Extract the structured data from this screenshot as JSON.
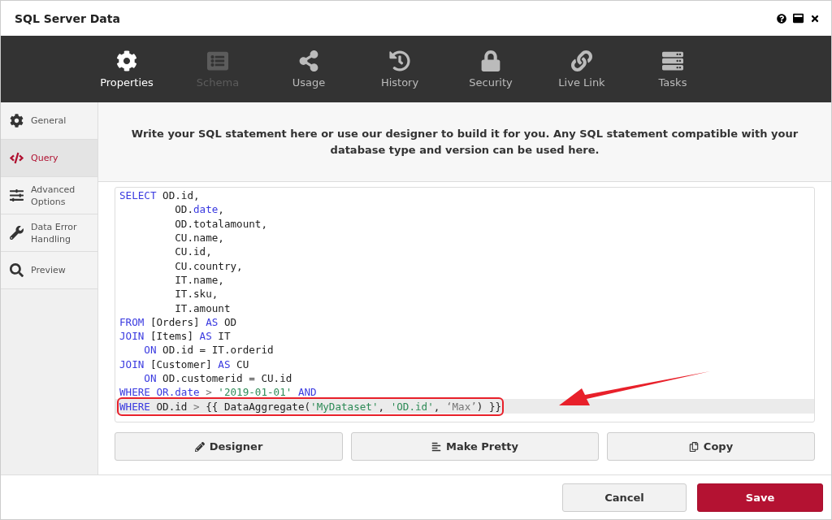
{
  "window": {
    "title": "SQL Server Data"
  },
  "nav_tabs": [
    {
      "label": "Properties",
      "selected": true,
      "disabled": false
    },
    {
      "label": "Schema",
      "selected": false,
      "disabled": true
    },
    {
      "label": "Usage",
      "selected": false,
      "disabled": false
    },
    {
      "label": "History",
      "selected": false,
      "disabled": false
    },
    {
      "label": "Security",
      "selected": false,
      "disabled": false
    },
    {
      "label": "Live Link",
      "selected": false,
      "disabled": false
    },
    {
      "label": "Tasks",
      "selected": false,
      "disabled": false
    }
  ],
  "sidebar": {
    "items": [
      {
        "label": "General",
        "selected": false
      },
      {
        "label": "Query",
        "selected": true
      },
      {
        "label": "Advanced Options",
        "selected": false
      },
      {
        "label": "Data Error Handling",
        "selected": false
      },
      {
        "label": "Preview",
        "selected": false
      }
    ]
  },
  "description": "Write your SQL statement here or use our designer to build it for you. Any SQL statement compatible with your database type and version can be used here.",
  "editor": {
    "lines": [
      {
        "highlighted": false,
        "tokens": [
          {
            "t": "SELECT",
            "kind": "keyword"
          },
          {
            "t": " OD.id,",
            "kind": "plain"
          }
        ]
      },
      {
        "highlighted": false,
        "tokens": [
          {
            "t": "         OD.",
            "kind": "plain"
          },
          {
            "t": "date",
            "kind": "keyword"
          },
          {
            "t": ",",
            "kind": "plain"
          }
        ]
      },
      {
        "highlighted": false,
        "tokens": [
          {
            "t": "         OD.totalamount,",
            "kind": "plain"
          }
        ]
      },
      {
        "highlighted": false,
        "tokens": [
          {
            "t": "         CU.name,",
            "kind": "plain"
          }
        ]
      },
      {
        "highlighted": false,
        "tokens": [
          {
            "t": "         CU.id,",
            "kind": "plain"
          }
        ]
      },
      {
        "highlighted": false,
        "tokens": [
          {
            "t": "         CU.country,",
            "kind": "plain"
          }
        ]
      },
      {
        "highlighted": false,
        "tokens": [
          {
            "t": "         IT.name,",
            "kind": "plain"
          }
        ]
      },
      {
        "highlighted": false,
        "tokens": [
          {
            "t": "         IT.sku,",
            "kind": "plain"
          }
        ]
      },
      {
        "highlighted": false,
        "tokens": [
          {
            "t": "         IT.amount",
            "kind": "plain"
          }
        ]
      },
      {
        "highlighted": false,
        "tokens": [
          {
            "t": "FROM",
            "kind": "keyword"
          },
          {
            "t": " [Orders] ",
            "kind": "plain"
          },
          {
            "t": "AS",
            "kind": "keyword"
          },
          {
            "t": " OD",
            "kind": "plain"
          }
        ]
      },
      {
        "highlighted": false,
        "tokens": [
          {
            "t": "JOIN",
            "kind": "keyword"
          },
          {
            "t": " [Items] ",
            "kind": "plain"
          },
          {
            "t": "AS",
            "kind": "keyword"
          },
          {
            "t": " IT",
            "kind": "plain"
          }
        ]
      },
      {
        "highlighted": false,
        "tokens": [
          {
            "t": "    ON",
            "kind": "keyword"
          },
          {
            "t": " OD.id = IT.orderid",
            "kind": "plain"
          }
        ]
      },
      {
        "highlighted": false,
        "tokens": [
          {
            "t": "JOIN",
            "kind": "keyword"
          },
          {
            "t": " [Customer] ",
            "kind": "plain"
          },
          {
            "t": "AS",
            "kind": "keyword"
          },
          {
            "t": " CU",
            "kind": "plain"
          }
        ]
      },
      {
        "highlighted": false,
        "tokens": [
          {
            "t": "    ON",
            "kind": "keyword"
          },
          {
            "t": " OD.customerid = CU.id",
            "kind": "plain"
          }
        ]
      },
      {
        "highlighted": false,
        "tokens": [
          {
            "t": "WHERE OR.date",
            "kind": "keyword"
          },
          {
            "t": " > ",
            "kind": "operator"
          },
          {
            "t": "'2019-01-01'",
            "kind": "string"
          },
          {
            "t": " AND",
            "kind": "keyword"
          }
        ]
      },
      {
        "highlighted": true,
        "tokens": [
          {
            "t": "WHERE",
            "kind": "keyword"
          },
          {
            "t": " OD.id ",
            "kind": "plain"
          },
          {
            "t": ">",
            "kind": "operator"
          },
          {
            "t": " {{ DataAggregate(",
            "kind": "plain"
          },
          {
            "t": "'MyDataset'",
            "kind": "string"
          },
          {
            "t": ", ",
            "kind": "plain"
          },
          {
            "t": "'OD.id'",
            "kind": "string"
          },
          {
            "t": ", ",
            "kind": "plain"
          },
          {
            "t": "‘Max’",
            "kind": "operator"
          },
          {
            "t": ") }}",
            "kind": "plain"
          }
        ]
      }
    ]
  },
  "editor_buttons": [
    {
      "label": "Designer"
    },
    {
      "label": "Make Pretty"
    },
    {
      "label": "Copy"
    }
  ],
  "footer_buttons": [
    {
      "label": "Cancel",
      "kind": "secondary"
    },
    {
      "label": "Save",
      "kind": "primary"
    }
  ]
}
